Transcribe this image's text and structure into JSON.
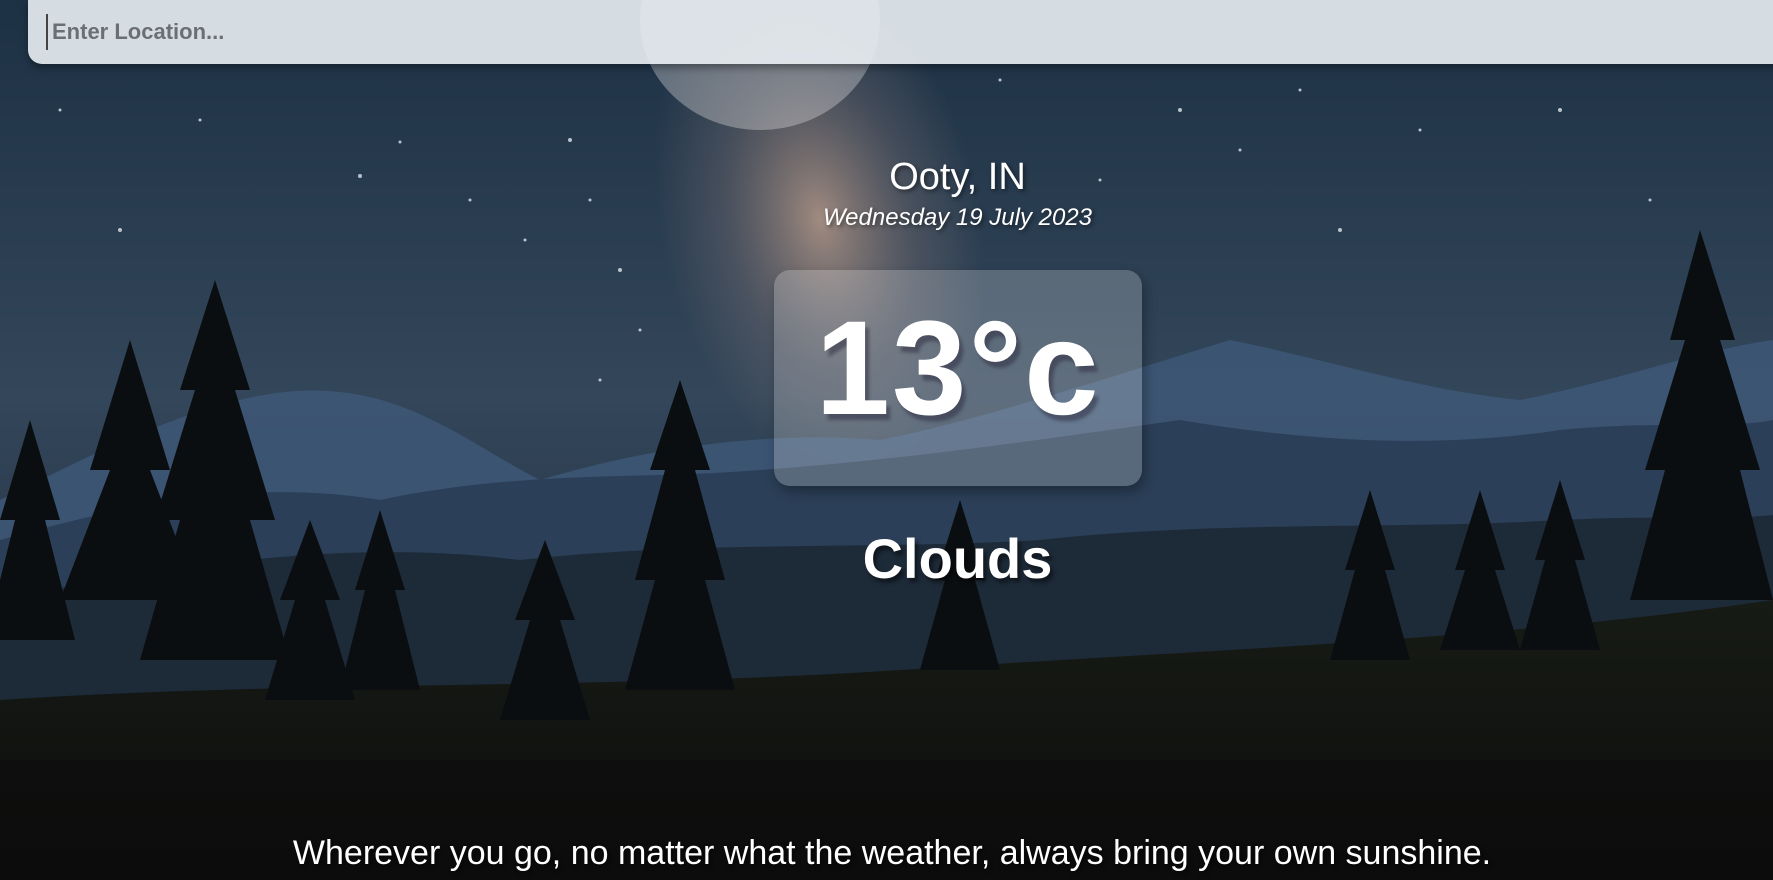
{
  "search": {
    "placeholder": "Enter Location..."
  },
  "weather": {
    "location": "Ooty, IN",
    "date": "Wednesday 19 July 2023",
    "temperature": "13°c",
    "condition": "Clouds"
  },
  "footer": {
    "quote": "Wherever you go, no matter what the weather, always bring your own sunshine."
  },
  "colors": {
    "sky_top": "#1f3347",
    "sky_bottom": "#3c4f62",
    "mountain": "#3e5878",
    "tree": "#0c0f12",
    "ground": "#11130f"
  }
}
